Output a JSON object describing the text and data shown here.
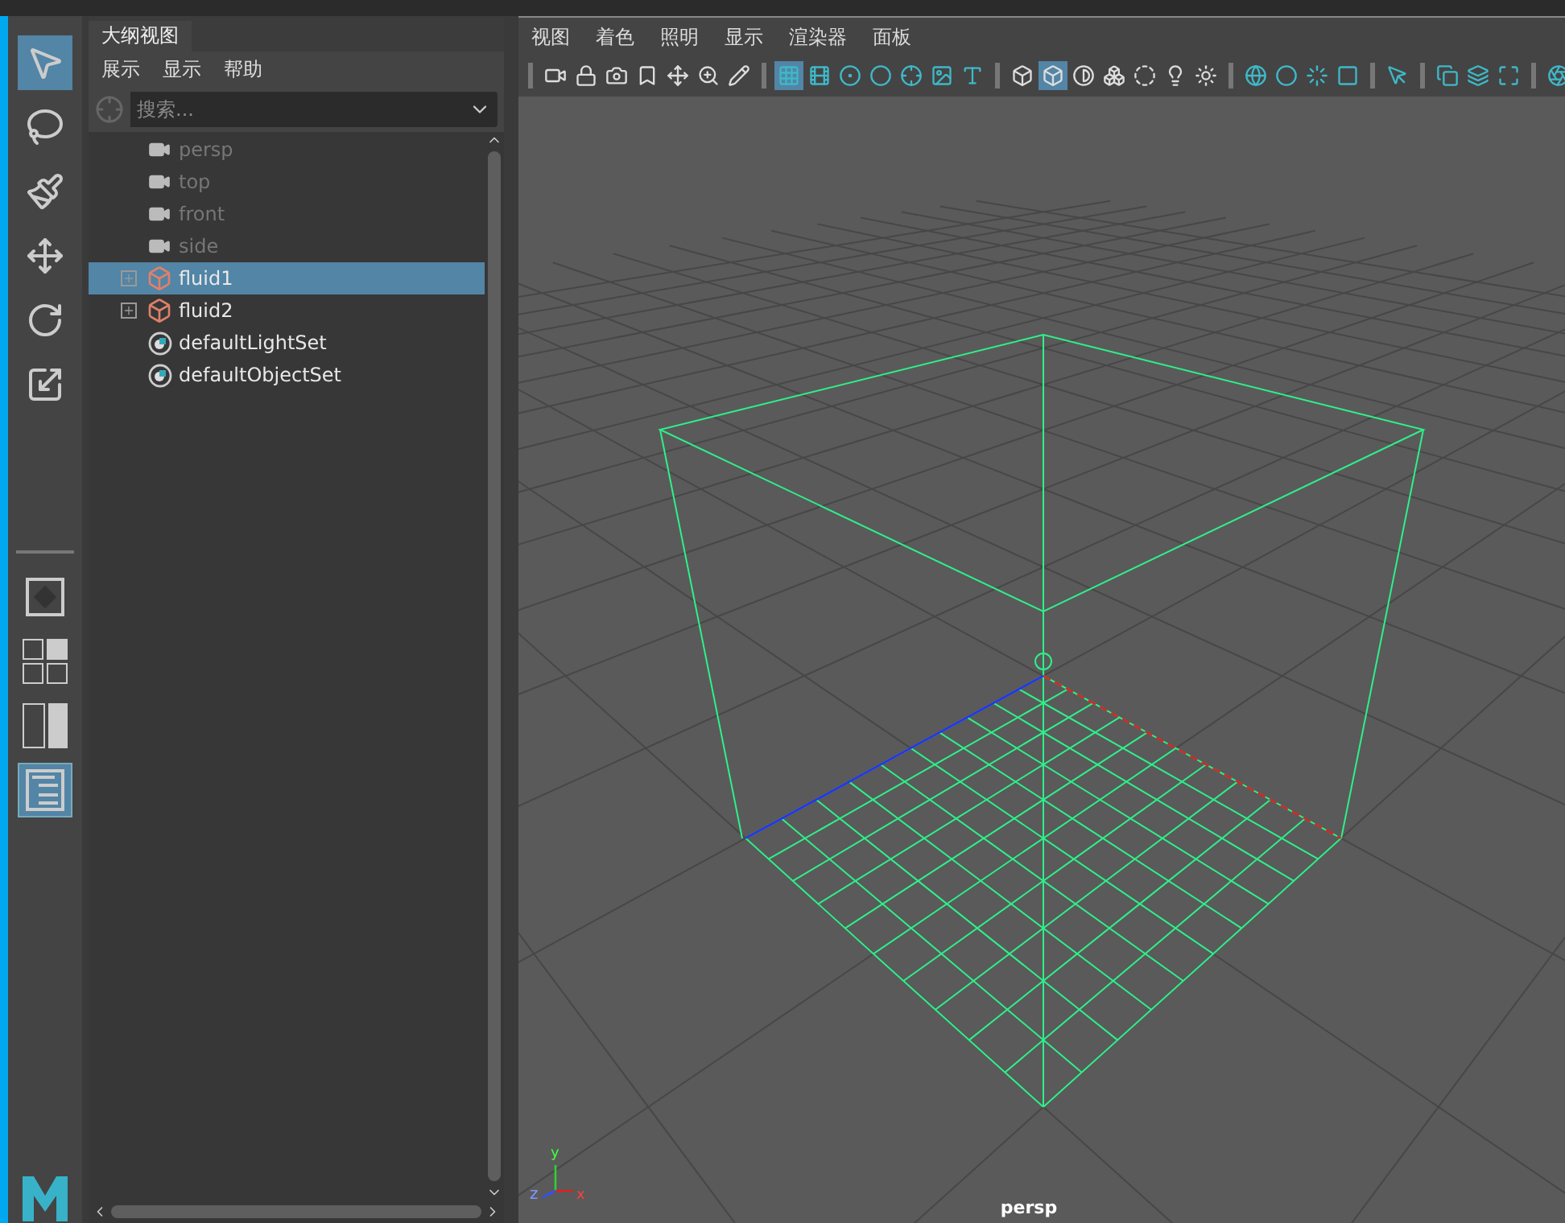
{
  "tools": [
    {
      "selected": true
    },
    {
      "selected": false
    },
    {
      "selected": false
    },
    {
      "selected": false
    },
    {
      "selected": false
    },
    {
      "selected": false
    }
  ],
  "layouts": [
    {
      "selected": false
    },
    {
      "selected": false
    },
    {
      "selected": false
    },
    {
      "selected": true
    }
  ],
  "outliner": {
    "tab": "大纲视图",
    "menus": [
      "展示",
      "显示",
      "帮助"
    ],
    "search": {
      "placeholder": "搜索..."
    },
    "items": [
      {
        "name": "persp",
        "kind": "camera",
        "dimmed": true,
        "expandable": false,
        "selected": false
      },
      {
        "name": "top",
        "kind": "camera",
        "dimmed": true,
        "expandable": false,
        "selected": false
      },
      {
        "name": "front",
        "kind": "camera",
        "dimmed": true,
        "expandable": false,
        "selected": false
      },
      {
        "name": "side",
        "kind": "camera",
        "dimmed": true,
        "expandable": false,
        "selected": false
      },
      {
        "name": "fluid1",
        "kind": "fluid",
        "dimmed": false,
        "expandable": true,
        "selected": true
      },
      {
        "name": "fluid2",
        "kind": "fluid",
        "dimmed": false,
        "expandable": true,
        "selected": false
      },
      {
        "name": "defaultLightSet",
        "kind": "set",
        "dimmed": false,
        "expandable": false,
        "selected": false
      },
      {
        "name": "defaultObjectSet",
        "kind": "set",
        "dimmed": false,
        "expandable": false,
        "selected": false
      }
    ]
  },
  "viewport": {
    "menus": [
      "视图",
      "着色",
      "照明",
      "显示",
      "渲染器",
      "面板"
    ],
    "toolbar": [
      [
        {
          "selected": false
        },
        {
          "selected": false
        },
        {
          "selected": false
        },
        {
          "selected": false
        },
        {
          "selected": false
        },
        {
          "selected": false
        },
        {
          "selected": false
        }
      ],
      [
        {
          "selected": true
        },
        {
          "selected": false
        },
        {
          "selected": false
        },
        {
          "selected": false
        },
        {
          "selected": false
        },
        {
          "selected": false
        },
        {
          "selected": false
        }
      ],
      [
        {
          "selected": false
        },
        {
          "selected": true
        },
        {
          "selected": false
        },
        {
          "selected": false
        },
        {
          "selected": false
        },
        {
          "selected": false
        },
        {
          "selected": false
        }
      ],
      [
        {
          "selected": false
        },
        {
          "selected": false
        },
        {
          "selected": false
        },
        {
          "selected": false
        }
      ],
      [
        {
          "selected": false
        }
      ],
      [
        {
          "selected": false
        },
        {
          "selected": false
        },
        {
          "selected": false
        }
      ],
      [
        {
          "selected": false
        }
      ]
    ],
    "axis_labels": {
      "x": "x",
      "y": "y",
      "z": "z"
    },
    "camera_label": "persp"
  }
}
